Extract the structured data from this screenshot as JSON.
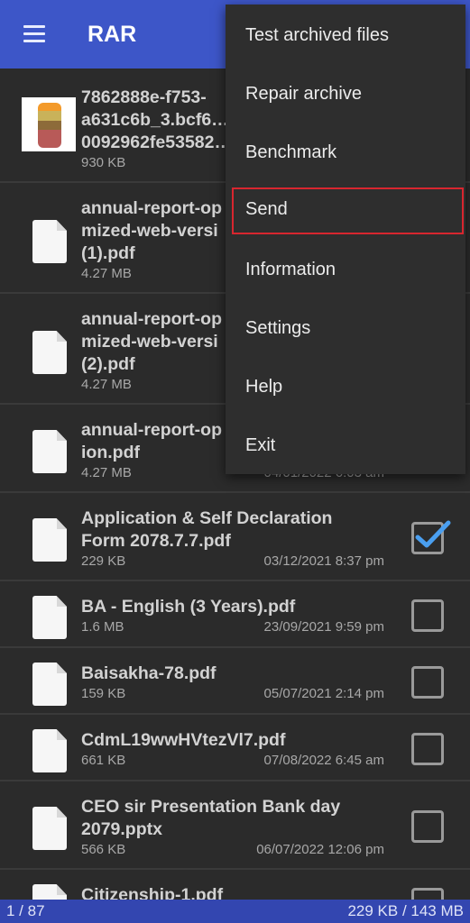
{
  "appbar": {
    "title": "RAR",
    "menu_icon": "hamburger-icon"
  },
  "files": [
    {
      "lines": [
        "7862888e-f753-",
        "a631c6b_3.bcf6…",
        "0092962fe53582…"
      ],
      "size": "930 KB",
      "date": "",
      "type": "image",
      "checked": null
    },
    {
      "lines": [
        "annual-report-op",
        "mized-web-versi",
        "(1).pdf"
      ],
      "size": "4.27 MB",
      "date": "",
      "type": "doc",
      "checked": null
    },
    {
      "lines": [
        "annual-report-op",
        "mized-web-versi",
        "(2).pdf"
      ],
      "size": "4.27 MB",
      "date": "",
      "type": "doc",
      "checked": null
    },
    {
      "lines": [
        "annual-report-op",
        "ion.pdf"
      ],
      "size": "4.27 MB",
      "date": "04/01/2022 6:03 am",
      "type": "doc",
      "checked": null
    },
    {
      "lines": [
        "Application & Self Declaration",
        "Form 2078.7.7.pdf"
      ],
      "size": "229 KB",
      "date": "03/12/2021 8:37 pm",
      "type": "doc",
      "checked": true
    },
    {
      "lines": [
        "BA - English (3 Years).pdf"
      ],
      "size": "1.6 MB",
      "date": "23/09/2021 9:59 pm",
      "type": "doc",
      "checked": false
    },
    {
      "lines": [
        "Baisakha-78.pdf"
      ],
      "size": "159 KB",
      "date": "05/07/2021 2:14 pm",
      "type": "doc",
      "checked": false
    },
    {
      "lines": [
        "CdmL19wwHVtezVl7.pdf"
      ],
      "size": "661 KB",
      "date": "07/08/2022 6:45 am",
      "type": "doc",
      "checked": false
    },
    {
      "lines": [
        "CEO sir Presentation Bank day",
        "2079.pptx"
      ],
      "size": "566 KB",
      "date": "06/07/2022 12:06 pm",
      "type": "doc",
      "checked": false
    },
    {
      "lines": [
        "Citizenship-1.pdf"
      ],
      "size": "",
      "date": "",
      "type": "doc",
      "checked": false
    }
  ],
  "menu": {
    "items": [
      "Test archived files",
      "Repair archive",
      "Benchmark",
      "Send",
      "Information",
      "Settings",
      "Help",
      "Exit"
    ],
    "highlighted": "Send",
    "highlight_color": "#d8262f"
  },
  "footer": {
    "selection": "1 / 87",
    "size": "229 KB / 143 MB"
  },
  "colors": {
    "appbar": "#3d56c8",
    "footer": "#3346b0",
    "check": "#4a9ff0"
  }
}
